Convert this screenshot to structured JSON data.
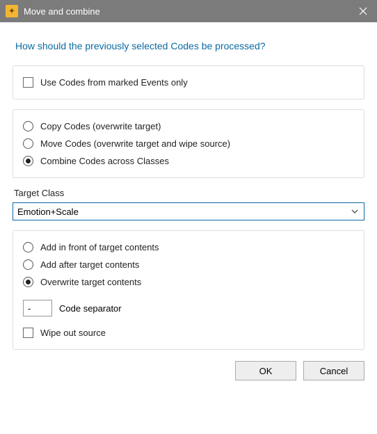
{
  "titlebar": {
    "title": "Move and combine"
  },
  "prompt": "How should the previously selected Codes be processed?",
  "markedOnly": {
    "label": "Use Codes from marked Events only",
    "checked": false
  },
  "modes": {
    "copy": {
      "label": "Copy Codes (overwrite target)",
      "checked": false
    },
    "move": {
      "label": "Move Codes  (overwrite target and wipe source)",
      "checked": false
    },
    "combine": {
      "label": "Combine Codes across Classes",
      "checked": true
    }
  },
  "targetClass": {
    "label": "Target Class",
    "value": "Emotion+Scale"
  },
  "placement": {
    "front": {
      "label": "Add in front of target contents",
      "checked": false
    },
    "after": {
      "label": "Add after target contents",
      "checked": false
    },
    "overwrite": {
      "label": "Overwrite target contents",
      "checked": true
    }
  },
  "separator": {
    "label": "Code separator",
    "value": "-"
  },
  "wipeSource": {
    "label": "Wipe out source",
    "checked": false
  },
  "buttons": {
    "ok": "OK",
    "cancel": "Cancel"
  }
}
